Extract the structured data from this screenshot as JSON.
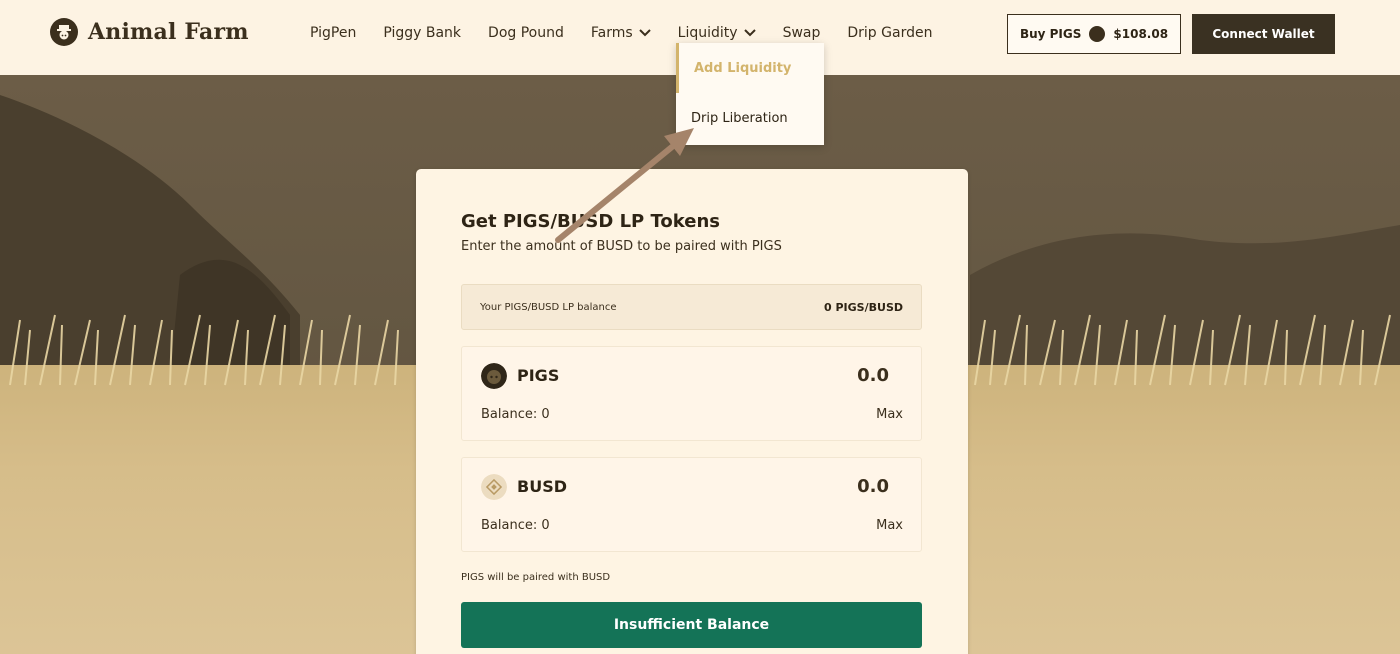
{
  "brand": {
    "name": "Animal Farm"
  },
  "nav": {
    "items": [
      {
        "label": "PigPen",
        "dropdown": false
      },
      {
        "label": "Piggy Bank",
        "dropdown": false
      },
      {
        "label": "Dog Pound",
        "dropdown": false
      },
      {
        "label": "Farms",
        "dropdown": true
      },
      {
        "label": "Liquidity",
        "dropdown": true
      },
      {
        "label": "Swap",
        "dropdown": false
      },
      {
        "label": "Drip Garden",
        "dropdown": false
      }
    ]
  },
  "header": {
    "buy_label": "Buy PIGS",
    "price": "$108.08",
    "connect_label": "Connect Wallet"
  },
  "dropdown": {
    "items": [
      {
        "label": "Add Liquidity",
        "active": true
      },
      {
        "label": "Drip Liberation",
        "active": false
      }
    ]
  },
  "card": {
    "title": "Get PIGS/BUSD LP Tokens",
    "subtitle": "Enter the amount of BUSD to be paired with PIGS",
    "lp_label": "Your PIGS/BUSD LP balance",
    "lp_value": "0 PIGS/BUSD",
    "tokens": [
      {
        "name": "PIGS",
        "amount": "0.0",
        "balance": "Balance: 0",
        "max": "Max",
        "icon": "pigs-token-icon"
      },
      {
        "name": "BUSD",
        "amount": "0.0",
        "balance": "Balance: 0",
        "max": "Max",
        "icon": "busd-token-icon"
      }
    ],
    "pair_note": "PIGS will be paired with BUSD",
    "submit_label": "Insufficient Balance"
  },
  "colors": {
    "header_bg": "#fdf3e3",
    "accent_green": "#147357",
    "dark_brown": "#3a3122",
    "active_gold": "#d3b46c"
  }
}
